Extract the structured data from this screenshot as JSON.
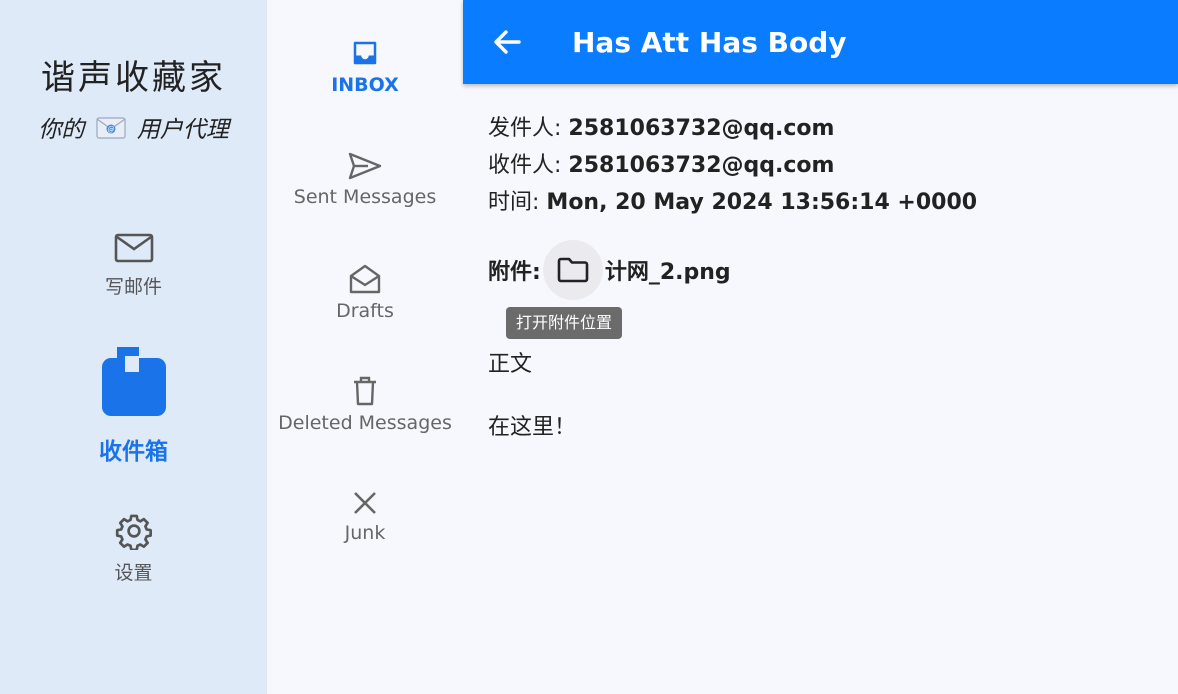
{
  "app": {
    "title": "谐声收藏家",
    "subtitle_prefix": "你的",
    "subtitle_suffix": "用户代理"
  },
  "rail": {
    "items": [
      {
        "label": "写邮件",
        "icon": "mail-outline-icon"
      },
      {
        "label": "收件箱",
        "icon": "mailbox-icon",
        "active": true
      },
      {
        "label": "设置",
        "icon": "gear-icon"
      }
    ]
  },
  "folders": [
    {
      "label": "INBOX",
      "icon": "inbox-icon",
      "active": true
    },
    {
      "label": "Sent Messages",
      "icon": "send-icon"
    },
    {
      "label": "Drafts",
      "icon": "drafts-icon"
    },
    {
      "label": "Deleted Messages",
      "icon": "trash-icon"
    },
    {
      "label": "Junk",
      "icon": "close-icon"
    }
  ],
  "header": {
    "title": "Has Att Has Body"
  },
  "message": {
    "from_label": "发件人:",
    "from": "2581063732@qq.com",
    "to_label": "收件人:",
    "to": "2581063732@qq.com",
    "time_label": "时间:",
    "time": "Mon, 20 May 2024 13:56:14 +0000",
    "attachment_label": "附件:",
    "attachment_name": "计网_2.png",
    "attachment_tooltip": "打开附件位置",
    "body_label": "正文",
    "body": "在这里！"
  },
  "colors": {
    "accent": "#0a7cff",
    "rail_bg": "#dfeaf9",
    "active": "#1a73e8"
  }
}
